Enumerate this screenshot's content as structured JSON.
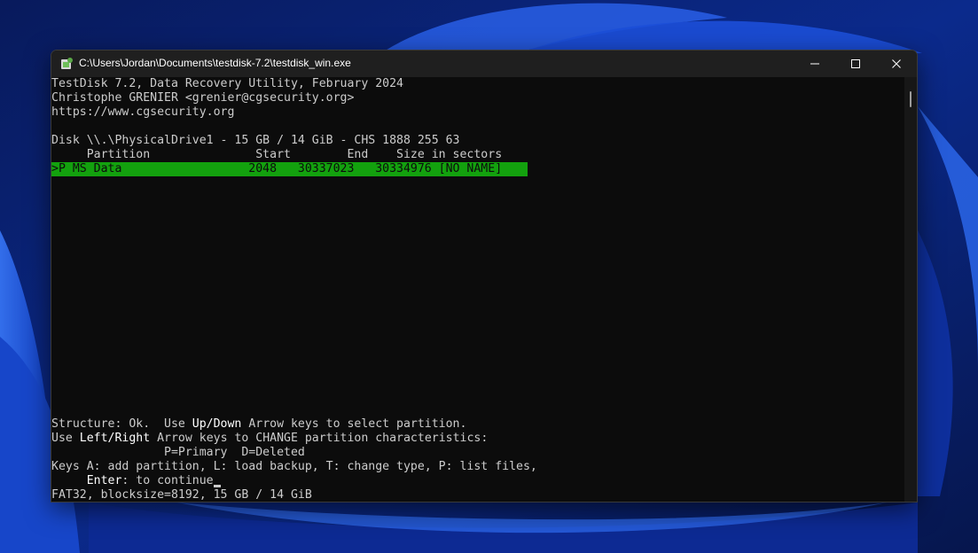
{
  "window": {
    "title": "C:\\Users\\Jordan\\Documents\\testdisk-7.2\\testdisk_win.exe",
    "controls": [
      "minimize",
      "maximize",
      "close"
    ]
  },
  "terminal": {
    "header": [
      "TestDisk 7.2, Data Recovery Utility, February 2024",
      "Christophe GRENIER <grenier@cgsecurity.org>",
      "https://www.cgsecurity.org"
    ],
    "disk_line": "Disk \\\\.\\PhysicalDrive1 - 15 GB / 14 GiB - CHS 1888 255 63",
    "columns_line": "     Partition               Start        End    Size in sectors",
    "selected_partition": {
      "marker": ">",
      "status": "P",
      "type": "MS Data",
      "start": "2048",
      "end": "30337023",
      "size": "30334976",
      "label": "[NO NAME]",
      "text": ">P MS Data                  2048   30337023   30334976 [NO NAME]"
    },
    "structure_line": {
      "prefix": "Structure: Ok.  Use ",
      "keys": "Up/Down",
      "suffix": " Arrow keys to select partition."
    },
    "change_line": {
      "prefix": "Use ",
      "keys": "Left/Right",
      "suffix": " Arrow keys to CHANGE partition characteristics:"
    },
    "legend_line": "                P=Primary  D=Deleted",
    "keys_line": "Keys A: add partition, L: load backup, T: change type, P: list files,",
    "enter_line": {
      "indent": "     ",
      "key": "Enter",
      "suffix": ": to continue"
    },
    "status_line": "FAT32, blocksize=8192, 15 GB / 14 GiB"
  },
  "colors": {
    "terminal_background": "#0c0c0c",
    "terminal_text": "#cccccc",
    "highlight_background": "#13a10e",
    "titlebar": "#1f1f1f"
  }
}
